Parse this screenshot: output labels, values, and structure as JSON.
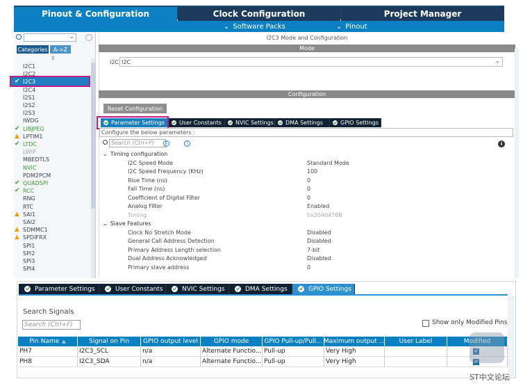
{
  "top_tabs": [
    "Pinout & Configuration",
    "Clock Configuration",
    "Project Manager"
  ],
  "sub_menu": [
    "Software Packs",
    "Pinout"
  ],
  "categories": {
    "btn1": "Categories",
    "btn2": "A->Z"
  },
  "peripherals": [
    {
      "label": "I2C1",
      "state": "normal"
    },
    {
      "label": "I2C2",
      "state": "normal"
    },
    {
      "label": "I2C3",
      "state": "selected"
    },
    {
      "label": "I2C4",
      "state": "normal"
    },
    {
      "label": "I2S1",
      "state": "normal"
    },
    {
      "label": "I2S2",
      "state": "normal"
    },
    {
      "label": "I2S3",
      "state": "normal"
    },
    {
      "label": "IWDG",
      "state": "normal"
    },
    {
      "label": "LIBJPEG",
      "state": "green"
    },
    {
      "label": "LPTIM1",
      "state": "warn"
    },
    {
      "label": "LTDC",
      "state": "green"
    },
    {
      "label": "LWIP",
      "state": "grey"
    },
    {
      "label": "MBEDTLS",
      "state": "normal"
    },
    {
      "label": "NVIC",
      "state": "greentext"
    },
    {
      "label": "PDM2PCM",
      "state": "normal"
    },
    {
      "label": "QUADSPI",
      "state": "green"
    },
    {
      "label": "RCC",
      "state": "green"
    },
    {
      "label": "RNG",
      "state": "normal"
    },
    {
      "label": "RTC",
      "state": "normal"
    },
    {
      "label": "SAI1",
      "state": "warn"
    },
    {
      "label": "SAI2",
      "state": "normal"
    },
    {
      "label": "SDMMC1",
      "state": "warn"
    },
    {
      "label": "SPDIFRX",
      "state": "warn"
    },
    {
      "label": "SPI1",
      "state": "normal"
    },
    {
      "label": "SPI2",
      "state": "normal"
    },
    {
      "label": "SPI3",
      "state": "normal"
    },
    {
      "label": "SPI4",
      "state": "normal"
    }
  ],
  "config_title": "I2C3 Mode and Configuration",
  "mode_header": "Mode",
  "mode_label": "I2C",
  "mode_value": "I2C",
  "configuration_header": "Configuration",
  "reset_button": "Reset Configuration",
  "settings_tabs": [
    "Parameter Settings",
    "User Constants",
    "NVIC Settings",
    "DMA Settings",
    "GPIO Settings"
  ],
  "configure_hint": "Configure the below parameters :",
  "search_placeholder": "Search (Ctrl+F)",
  "groups": [
    {
      "title": "Timing configuration",
      "params": [
        {
          "name": "I2C Speed Mode",
          "value": "Standard Mode",
          "grey": false
        },
        {
          "name": "I2C Speed Frequency (KHz)",
          "value": "100",
          "grey": false
        },
        {
          "name": "Rise Time (ns)",
          "value": "0",
          "grey": false
        },
        {
          "name": "Fall Time (ns)",
          "value": "0",
          "grey": false
        },
        {
          "name": "Coefficient of Digital Filter",
          "value": "0",
          "grey": false
        },
        {
          "name": "Analog Filter",
          "value": "Enabled",
          "grey": false
        },
        {
          "name": "Timing",
          "value": "0x20404768",
          "grey": true
        }
      ]
    },
    {
      "title": "Slave Features",
      "params": [
        {
          "name": "Clock No Stretch Mode",
          "value": "Disabled",
          "grey": false
        },
        {
          "name": "General Call Address Detection",
          "value": "Disabled",
          "grey": false
        },
        {
          "name": "Primary Address Length selection",
          "value": "7-bit",
          "grey": false
        },
        {
          "name": "Dual Address Acknowledged",
          "value": "Disabled",
          "grey": false
        },
        {
          "name": "Primary slave address",
          "value": "0",
          "grey": false
        }
      ]
    }
  ],
  "bottom_tabs": [
    "Parameter Settings",
    "User Constants",
    "NVIC Settings",
    "DMA Settings",
    "GPIO Settings"
  ],
  "search_signals": "Search Signals",
  "show_modified": "Show only Modified Pins",
  "gpio_headers": [
    "Pin Name",
    "Signal on Pin",
    "GPIO output level",
    "GPIO mode",
    "GPIO Pull-up/Pull...",
    "Maximum output ...",
    "User Label",
    "Modified"
  ],
  "gpio_rows": [
    [
      "PH7",
      "I2C3_SCL",
      "n/a",
      "Alternate Functio...",
      "Pull-up",
      "Very High",
      ""
    ],
    [
      "PH8",
      "I2C3_SDA",
      "n/a",
      "Alternate Functio...",
      "Pull-up",
      "Very High",
      ""
    ]
  ],
  "watermark": "ST中文论坛"
}
